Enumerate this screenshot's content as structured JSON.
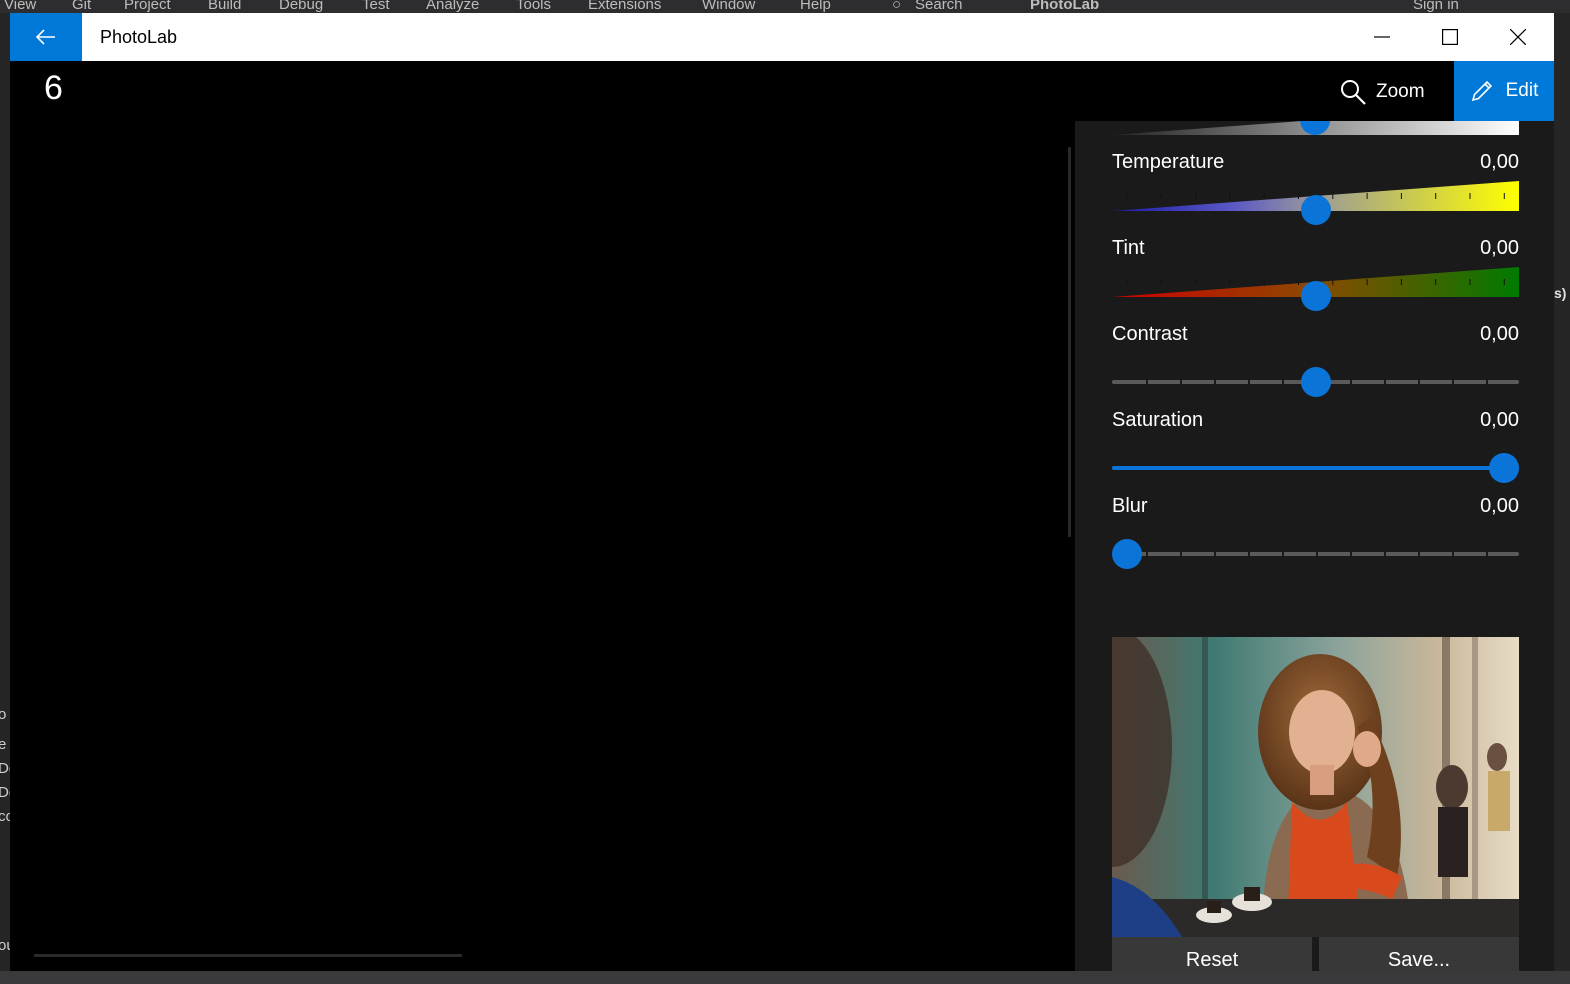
{
  "background_ide": {
    "menu": [
      "View",
      "Git",
      "Project",
      "Build",
      "Debug",
      "Test",
      "Analyze",
      "Tools",
      "Extensions",
      "Window",
      "Help"
    ],
    "search_label": "Search",
    "solution_name": "PhotoLab",
    "sign_in": "Sign in",
    "left_fragments": [
      "o",
      "e",
      "De",
      "De",
      "co",
      "ou"
    ],
    "right_fragment": "s)"
  },
  "window": {
    "title": "PhotoLab",
    "controls": [
      "minimize",
      "maximize",
      "close"
    ]
  },
  "toolbar": {
    "image_number": "6",
    "zoom_label": "Zoom",
    "edit_label": "Edit"
  },
  "colors": {
    "accent": "#0078d7",
    "panel_bg": "#1a1a1a",
    "track": "#5a5a5a",
    "button": "#383838"
  },
  "sliders": [
    {
      "label": "Temperature",
      "value": "0,00",
      "fraction": 0.5,
      "style": "temperature-gradient"
    },
    {
      "label": "Tint",
      "value": "0,00",
      "fraction": 0.5,
      "style": "tint-gradient"
    },
    {
      "label": "Contrast",
      "value": "0,00",
      "fraction": 0.5,
      "style": "plain"
    },
    {
      "label": "Saturation",
      "value": "0,00",
      "fraction": 1.0,
      "style": "plain-filled"
    },
    {
      "label": "Blur",
      "value": "0,00",
      "fraction": 0.0,
      "style": "plain"
    }
  ],
  "actions": {
    "reset_label": "Reset",
    "save_label": "Save..."
  }
}
